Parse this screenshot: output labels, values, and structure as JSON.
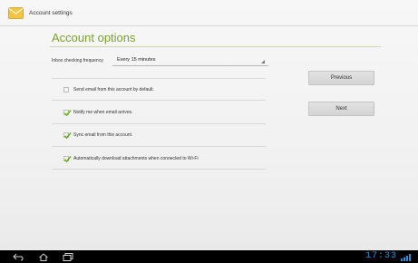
{
  "titlebar": {
    "title": "Account settings",
    "icon": "email-app-icon"
  },
  "heading": "Account options",
  "frequency": {
    "label": "Inbox checking frequency",
    "value": "Every 15 minutes"
  },
  "options": [
    {
      "label": "Send email from this account by default.",
      "checked": false
    },
    {
      "label": "Notify me when email arrives.",
      "checked": true
    },
    {
      "label": "Sync email from this account.",
      "checked": true
    },
    {
      "label": "Automatically download attachments when connected to Wi-Fi",
      "checked": true
    }
  ],
  "buttons": {
    "previous": "Previous",
    "next": "Next"
  },
  "navbar": {
    "clock": "17:33"
  },
  "colors": {
    "accent": "#7aa22a",
    "check": "#6fb21a",
    "clock": "#2a8fd6"
  }
}
